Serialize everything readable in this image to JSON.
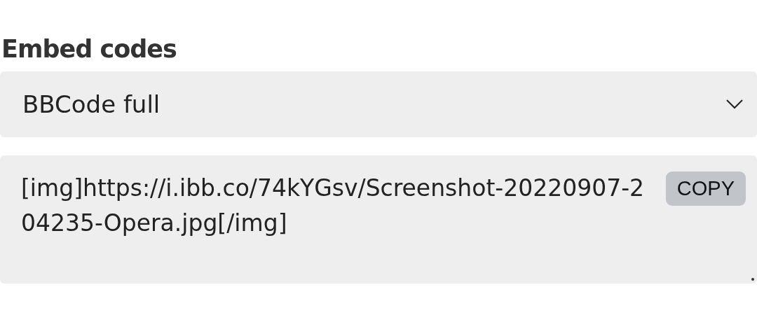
{
  "heading": "Embed codes",
  "select": {
    "value": "BBCode full"
  },
  "code_box": {
    "value": "[img]https://i.ibb.co/74kYGsv/Screenshot-20220907-204235-Opera.jpg[/img]",
    "copy_button": "COPY"
  }
}
